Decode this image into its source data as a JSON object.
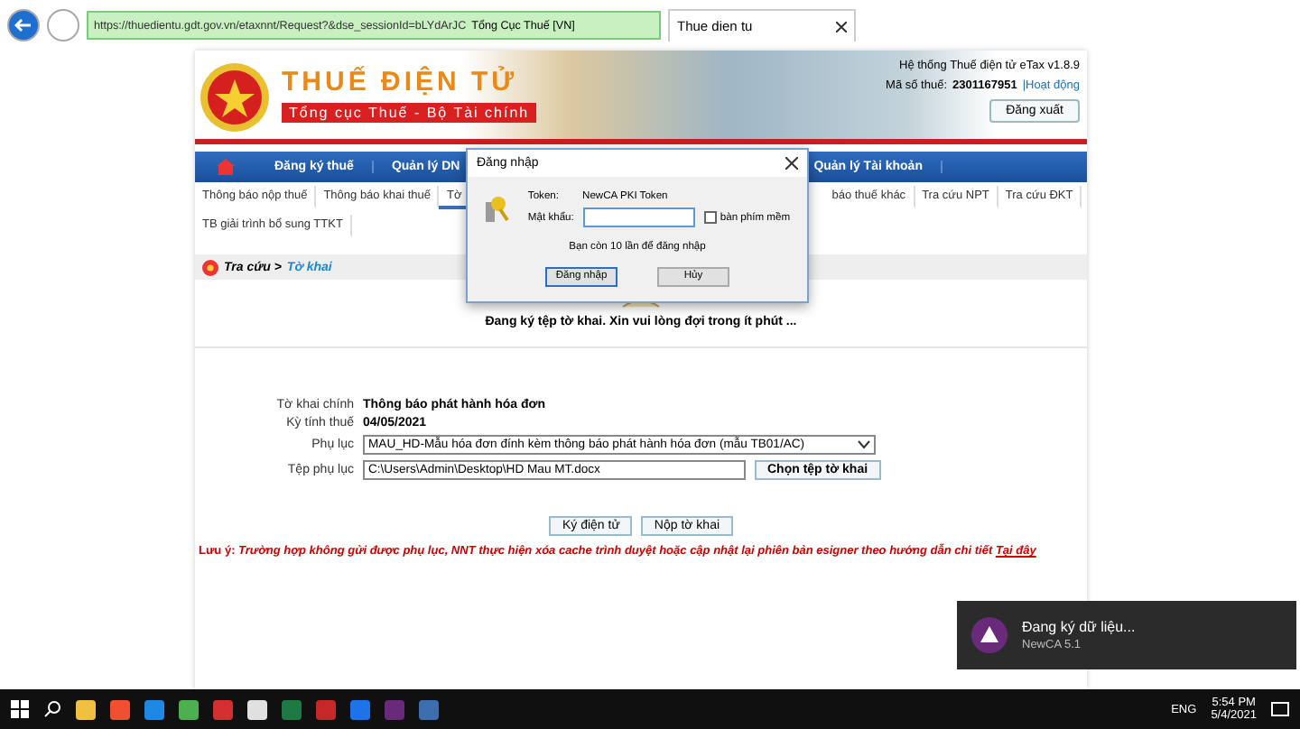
{
  "browser": {
    "url": "https://thuedientu.gdt.gov.vn/etaxnnt/Request?&dse_sessionId=bLYdArJC",
    "site_identity": "Tổng Cục Thuế [VN]",
    "tab_title": "Thue dien tu"
  },
  "header": {
    "logo_title": "THUẾ ĐIỆN TỬ",
    "logo_subtitle": "Tổng cục Thuế - Bộ Tài chính",
    "system": "Hệ thống Thuế điện tử eTax v1.8.9",
    "tax_id_label": "Mã số thuế:",
    "tax_id": "2301167951",
    "status_link": "|Hoạt động",
    "logout": "Đăng xuất"
  },
  "nav_left": [
    "Đăng ký thuế",
    "Quản lý DN"
  ],
  "nav_right": [
    "Quản lý Tài khoản"
  ],
  "submenu_left": [
    {
      "label": "Thông báo nộp thuế",
      "selected": false
    },
    {
      "label": "Thông báo khai thuế",
      "selected": false
    },
    {
      "label": "Tờ",
      "selected": true
    }
  ],
  "submenu_right": [
    {
      "label": "báo thuế khác",
      "selected": false
    },
    {
      "label": "Tra cứu NPT",
      "selected": false
    },
    {
      "label": "Tra cứu ĐKT",
      "selected": false
    }
  ],
  "submenu_row2": [
    {
      "label": "TB giải trình bổ sung TTKT",
      "selected": false
    }
  ],
  "breadcrumb": {
    "section": "Tra cứu >",
    "current": "Tờ khai"
  },
  "status_message": "Đang ký tệp tờ khai. Xin vui lòng đợi trong ít phút ...",
  "form": [
    {
      "kind": "text",
      "label": "Tờ khai chính",
      "value": "Thông báo phát hành hóa đơn"
    },
    {
      "kind": "text",
      "label": "Kỳ tính thuế",
      "value": "04/05/2021"
    },
    {
      "kind": "select",
      "label": "Phụ lục",
      "value": "MAU_HD-Mẫu hóa đơn đính kèm thông báo phát hành hóa đơn (mẫu TB01/AC)"
    },
    {
      "kind": "file",
      "label": "Tệp phụ lục",
      "value": "C:\\Users\\Admin\\Desktop\\HD Mau MT.docx",
      "button": "Chọn tệp tờ khai"
    }
  ],
  "actions": [
    "Ký điện tử",
    "Nộp tờ khai"
  ],
  "note": {
    "text": "Lưu ý: *Trường hợp không gửi được phụ lục, NNT thực hiện xóa cache trình duyệt hoặc cập nhật lại phiên bản esigner theo hướng dẫn chi tiết*",
    "link": "Tại đây"
  },
  "dialog": {
    "title": "Đăng nhập",
    "token_label": "Token:",
    "token_value": "NewCA PKI Token",
    "password_label": "Mật khẩu:",
    "keyboard": {
      "label": "bàn phím mềm",
      "checked": false
    },
    "hint": "Bạn còn 10 lần để đăng nhập",
    "buttons": [
      {
        "label": "Đăng nhập",
        "default": true
      },
      {
        "label": "Hủy",
        "default": false
      }
    ]
  },
  "notification": {
    "title": "Đang ký dữ liệu...",
    "subtitle": "NewCA 5.1"
  },
  "taskbar": {
    "language": "ENG",
    "time": "5:54 PM",
    "date": "5/4/2021"
  }
}
